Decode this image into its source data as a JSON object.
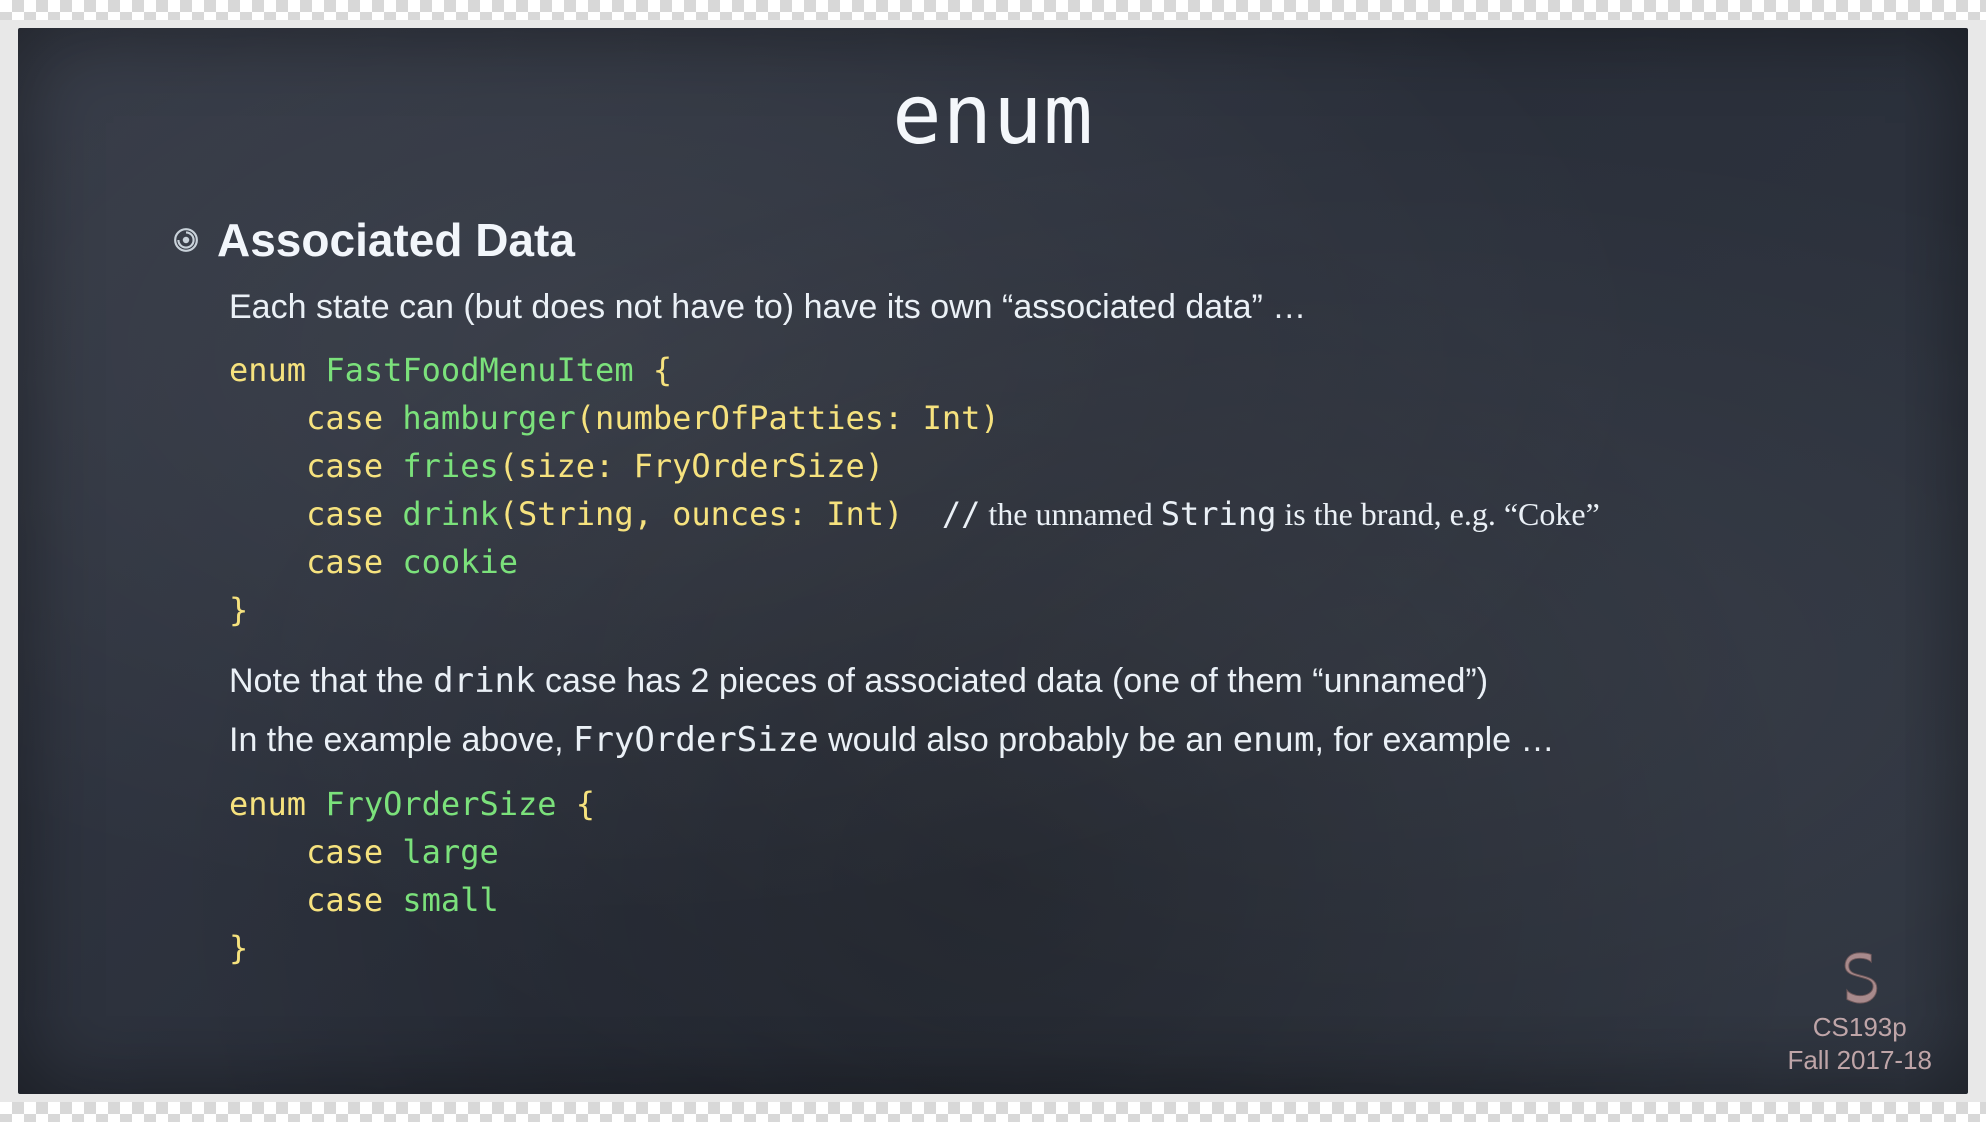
{
  "title": "enum",
  "heading": "Associated Data",
  "intro": "Each state can (but does not have to) have its own “associated data” …",
  "code1": {
    "l1_kw": "enum",
    "l1_type": "FastFoodMenuItem",
    "l1_brace": "{",
    "l2_kw": "case",
    "l2_name": "hamburger",
    "l2_params": "(numberOfPatties: Int)",
    "l3_kw": "case",
    "l3_name": "fries",
    "l3_params": "(size: FryOrderSize)",
    "l4_kw": "case",
    "l4_name": "drink",
    "l4_params": "(String, ounces: Int)",
    "l4_comment_slashes": "//",
    "l4_comment_pre": " the unnamed ",
    "l4_comment_mono": "String",
    "l4_comment_post": " is the brand, e.g. “Coke”",
    "l5_kw": "case",
    "l5_name": "cookie",
    "l6_brace": "}"
  },
  "note1_pre": "Note that the ",
  "note1_mono": "drink",
  "note1_post": " case has 2 pieces of associated data (one of them “unnamed”)",
  "note2_pre": "In the example above, ",
  "note2_mono1": "FryOrderSize",
  "note2_mid": " would also probably be an ",
  "note2_mono2": "enum",
  "note2_post": ", for example …",
  "code2": {
    "l1_kw": "enum",
    "l1_type": "FryOrderSize",
    "l1_brace": "{",
    "l2_kw": "case",
    "l2_name": "large",
    "l3_kw": "case",
    "l3_name": "small",
    "l4_brace": "}"
  },
  "footer": {
    "course": "CS193p",
    "term": "Fall 2017-18"
  }
}
